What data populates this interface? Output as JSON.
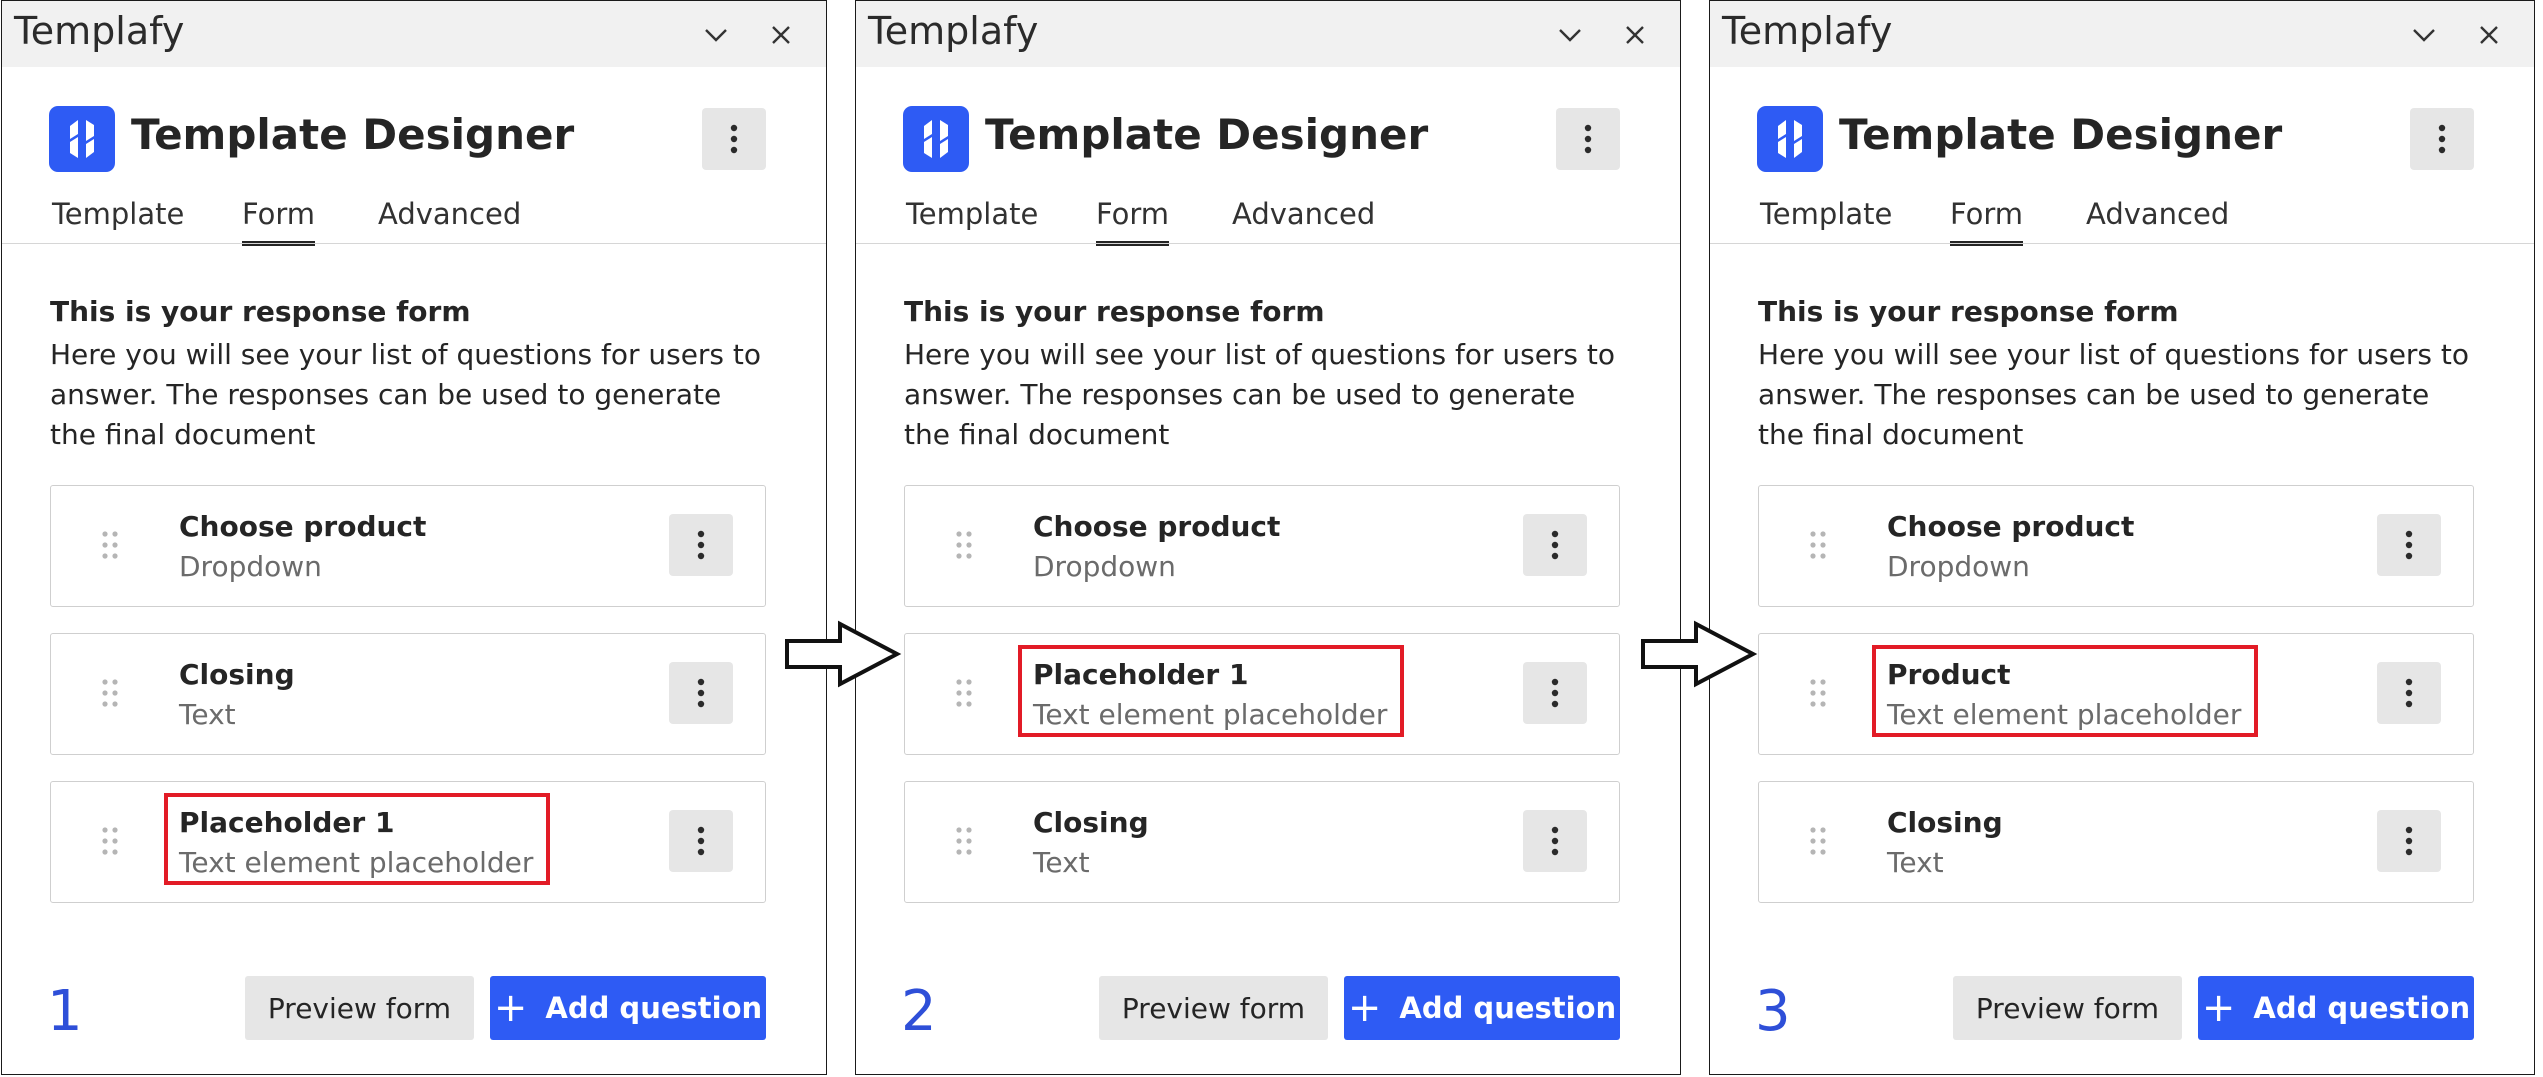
{
  "app_title": "Templafy",
  "designer_title": "Template Designer",
  "tabs": [
    "Template",
    "Form",
    "Advanced"
  ],
  "active_tab": "Form",
  "intro": {
    "heading": "This is your response form",
    "body": "Here you will see your list of questions for users to answer. The responses can be used to generate the final document"
  },
  "buttons": {
    "preview": "Preview form",
    "add": "Add question",
    "add_icon": "+"
  },
  "icons": {
    "minimize": "chevron-down-icon",
    "close": "close-icon",
    "more": "more-vertical-icon",
    "drag": "drag-handle-icon",
    "logo": "templafy-logo"
  },
  "colors": {
    "accent": "#2e5bf4",
    "highlight": "#e21b26",
    "step_number": "#2e4fd8"
  },
  "panels": [
    {
      "step": "1",
      "questions": [
        {
          "title": "Choose product",
          "type": "Dropdown",
          "highlighted": false
        },
        {
          "title": "Closing",
          "type": "Text",
          "highlighted": false
        },
        {
          "title": "Placeholder 1",
          "type": "Text element placeholder",
          "highlighted": true
        }
      ]
    },
    {
      "step": "2",
      "questions": [
        {
          "title": "Choose product",
          "type": "Dropdown",
          "highlighted": false
        },
        {
          "title": "Placeholder 1",
          "type": "Text element placeholder",
          "highlighted": true
        },
        {
          "title": "Closing",
          "type": "Text",
          "highlighted": false
        }
      ]
    },
    {
      "step": "3",
      "questions": [
        {
          "title": "Choose product",
          "type": "Dropdown",
          "highlighted": false
        },
        {
          "title": "Product",
          "type": "Text element placeholder",
          "highlighted": true
        },
        {
          "title": "Closing",
          "type": "Text",
          "highlighted": false
        }
      ]
    }
  ]
}
